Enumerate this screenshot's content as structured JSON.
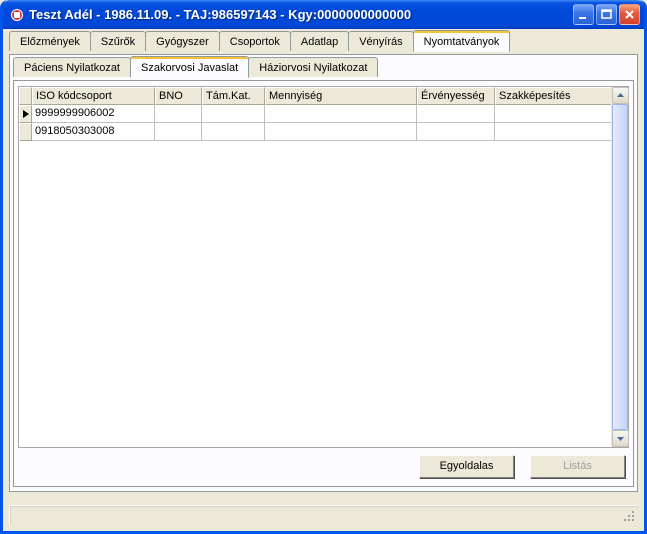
{
  "window": {
    "title": "Teszt Adél - 1986.11.09. - TAJ:986597143 - Kgy:0000000000000"
  },
  "main_tabs": [
    {
      "label": "Előzmények",
      "active": false
    },
    {
      "label": "Szűrők",
      "active": false
    },
    {
      "label": "Gyógyszer",
      "active": false
    },
    {
      "label": "Csoportok",
      "active": false
    },
    {
      "label": "Adatlap",
      "active": false
    },
    {
      "label": "Vényírás",
      "active": false
    },
    {
      "label": "Nyomtatványok",
      "active": true
    }
  ],
  "sub_tabs": [
    {
      "label": "Páciens Nyilatkozat",
      "active": false
    },
    {
      "label": "Szakorvosi Javaslat",
      "active": true
    },
    {
      "label": "Háziorvosi Nyilatkozat",
      "active": false
    }
  ],
  "grid": {
    "columns": [
      "ISO kódcsoport",
      "BNO",
      "Tám.Kat.",
      "Mennyiség",
      "Érvényesség",
      "Szakképesítés"
    ],
    "rows": [
      {
        "selected": true,
        "iso": "9999999906002",
        "bno": "",
        "tamkat": "",
        "mennyiseg": "",
        "ervenyesseg": "",
        "szakkepesites": ""
      },
      {
        "selected": false,
        "iso": "0918050303008",
        "bno": "",
        "tamkat": "",
        "mennyiseg": "",
        "ervenyesseg": "",
        "szakkepesites": ""
      }
    ]
  },
  "buttons": {
    "egyoldalas": "Egyoldalas",
    "listas": "Listás"
  }
}
